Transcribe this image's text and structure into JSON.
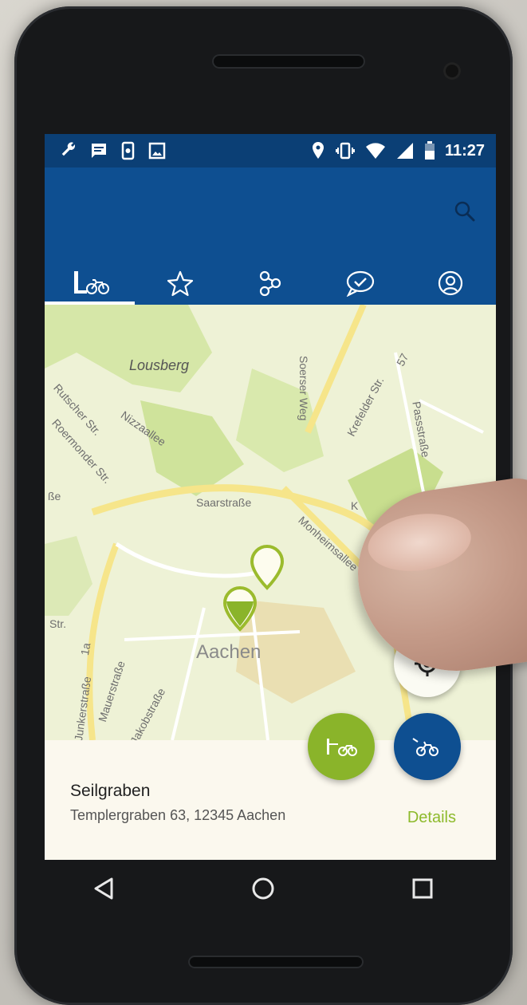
{
  "statusbar": {
    "icons_left": [
      "wrench-icon",
      "message-icon",
      "phone-sync-icon",
      "image-icon"
    ],
    "icons_right": [
      "location-icon",
      "vibrate-icon",
      "wifi-icon",
      "signal-icon",
      "battery-icon"
    ],
    "time": "11:27"
  },
  "appbar": {
    "search_icon": "search-icon",
    "tabs": [
      {
        "icon": "bike-station-icon",
        "active": true
      },
      {
        "icon": "star-icon",
        "active": false
      },
      {
        "icon": "route-icon",
        "active": false
      },
      {
        "icon": "chat-check-icon",
        "active": false
      },
      {
        "icon": "profile-icon",
        "active": false
      }
    ]
  },
  "map": {
    "labels": {
      "lousberg": "Lousberg",
      "rutscher": "Rutscher Str.",
      "nizzaallee": "Nizzaallee",
      "roermonder": "Roermonder Str.",
      "soerser": "Soerser Weg",
      "krefelder": "Krefelder Str.",
      "krefelder_num": "57",
      "passstrasse": "Passstraße",
      "saarstrasse": "Saarstraße",
      "monheimsallee": "Monheimsallee",
      "aachen": "Aachen",
      "mauerstrasse": "Mauerstraße",
      "jakobstrasse": "Jakobstraße",
      "junkerstrasse": "Junkerstraße",
      "strasse_left": "ße",
      "str_left": "Str.",
      "num_1a": "1a",
      "num_1": "1",
      "k_partial": "K"
    },
    "colors": {
      "primary": "#0e4f91",
      "accent_green": "#8ab42a",
      "statusbar": "#0b3f75"
    }
  },
  "bottom_sheet": {
    "title": "Seilgraben",
    "address": "Templergraben 63, 12345 Aachen",
    "details": "Details"
  },
  "nav": [
    "back-icon",
    "home-icon",
    "recents-icon"
  ]
}
